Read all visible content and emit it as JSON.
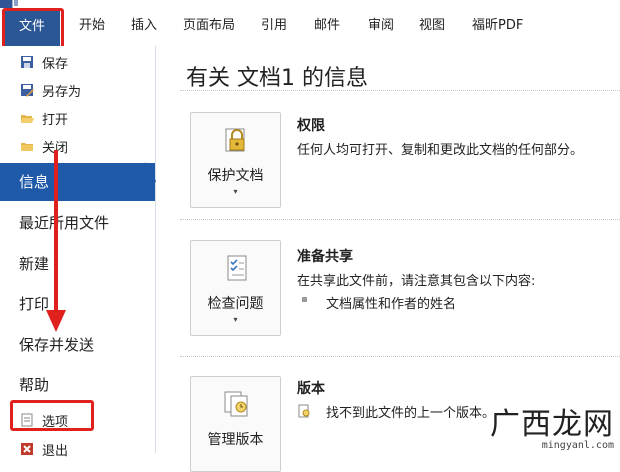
{
  "ribbon": {
    "file_tab": "文件",
    "tabs": [
      "开始",
      "插入",
      "页面布局",
      "引用",
      "邮件",
      "审阅",
      "视图",
      "福昕PDF"
    ]
  },
  "nav": {
    "commands": [
      {
        "label": "保存",
        "icon": "save-icon"
      },
      {
        "label": "另存为",
        "icon": "save-as-icon"
      },
      {
        "label": "打开",
        "icon": "open-folder-icon"
      },
      {
        "label": "关闭",
        "icon": "close-folder-icon"
      }
    ],
    "items": [
      {
        "label": "信息",
        "selected": true
      },
      {
        "label": "最近所用文件",
        "selected": false
      },
      {
        "label": "新建",
        "selected": false
      },
      {
        "label": "打印",
        "selected": false
      },
      {
        "label": "保存并发送",
        "selected": false
      },
      {
        "label": "帮助",
        "selected": false
      }
    ],
    "bottom_commands": [
      {
        "label": "选项",
        "icon": "options-icon"
      },
      {
        "label": "退出",
        "icon": "exit-icon"
      }
    ]
  },
  "main": {
    "title": "有关 文档1 的信息",
    "sections": [
      {
        "button_label": "保护文档",
        "button_icon": "lock-key-icon",
        "title": "权限",
        "description": "任何人均可打开、复制和更改此文档的任何部分。"
      },
      {
        "button_label": "检查问题",
        "button_icon": "checklist-icon",
        "title": "准备共享",
        "description": "在共享此文件前，请注意其包含以下内容:",
        "bullets": [
          "文档属性和作者的姓名"
        ]
      },
      {
        "button_label": "管理版本",
        "button_icon": "versions-icon",
        "title": "版本",
        "description": "找不到此文件的上一个版本。"
      }
    ]
  },
  "watermark": {
    "logo": "广西龙网",
    "url": "mingyanl.com"
  },
  "colors": {
    "accent": "#1e5aa8",
    "file_tab": "#2b5797",
    "annotation_red": "#e0201d"
  }
}
